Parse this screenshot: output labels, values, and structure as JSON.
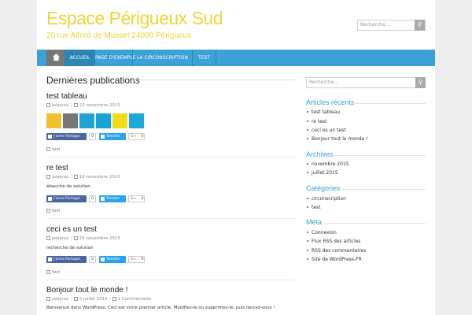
{
  "site": {
    "title": "Espace Périgueux Sud",
    "description": "20 rue Alfred de Musset 24000 Périgueux",
    "search_placeholder": "Recherche..."
  },
  "nav": {
    "home_icon": "home-icon",
    "items": [
      {
        "label": "ACCUEIL",
        "active": true
      },
      {
        "label": "PAGE D'EXEMPLE",
        "active": false
      },
      {
        "label": "LA CIRCONSCRIPTION",
        "active": false
      },
      {
        "label": "TEST",
        "active": false
      }
    ]
  },
  "main": {
    "section_title": "Dernières publications",
    "share": {
      "facebook_label": "J'aime Partager",
      "facebook_count": "0",
      "twitter_label": "Tweeter",
      "google_label": "G+",
      "google_count": "0"
    },
    "posts": [
      {
        "title": "test tableau",
        "author": "jalayrac",
        "date": "22 novembre 2015",
        "excerpt": "",
        "category": "test",
        "swatch_colors": [
          "#f0c030",
          "#777777",
          "#1fa3d6",
          "#16a4d2",
          "#f0dc17",
          "#1aa8d8"
        ]
      },
      {
        "title": "re test",
        "author": "jalayrac",
        "date": "16 novembre 2015",
        "excerpt": "ébauche de solution",
        "category": "test"
      },
      {
        "title": "ceci es un test",
        "author": "jalayrac",
        "date": "16 novembre 2015",
        "excerpt": "recherche de solution",
        "category": "test"
      },
      {
        "title": "Bonjour tout le monde !",
        "author": "jalayrac",
        "date": "5 juillet 2015",
        "comments": "1 Commentaire",
        "excerpt": "Bienvenue dans WordPress. Ceci est votre premier article. Modifiez-le ou supprimez-le, puis lancez-vous !"
      }
    ]
  },
  "sidebar": {
    "search_placeholder": "Recherche...",
    "widgets": [
      {
        "title": "Articles récents",
        "items": [
          "test tableau",
          "re test",
          "ceci es un test",
          "Bonjour tout le monde !"
        ]
      },
      {
        "title": "Archives",
        "items": [
          "novembre 2015",
          "juillet 2015"
        ]
      },
      {
        "title": "Catégories",
        "items": [
          "circonscription",
          "test"
        ]
      },
      {
        "title": "Méta",
        "items": [
          "Connexion",
          "Flux RSS des articles",
          "RSS des commentaires",
          "Site de WordPress-FR"
        ]
      }
    ]
  },
  "colors": {
    "accent": "#3ba1d7",
    "title_yellow": "#f0d43a",
    "nav_active": "#2b86b6",
    "nav_home": "#777777"
  }
}
